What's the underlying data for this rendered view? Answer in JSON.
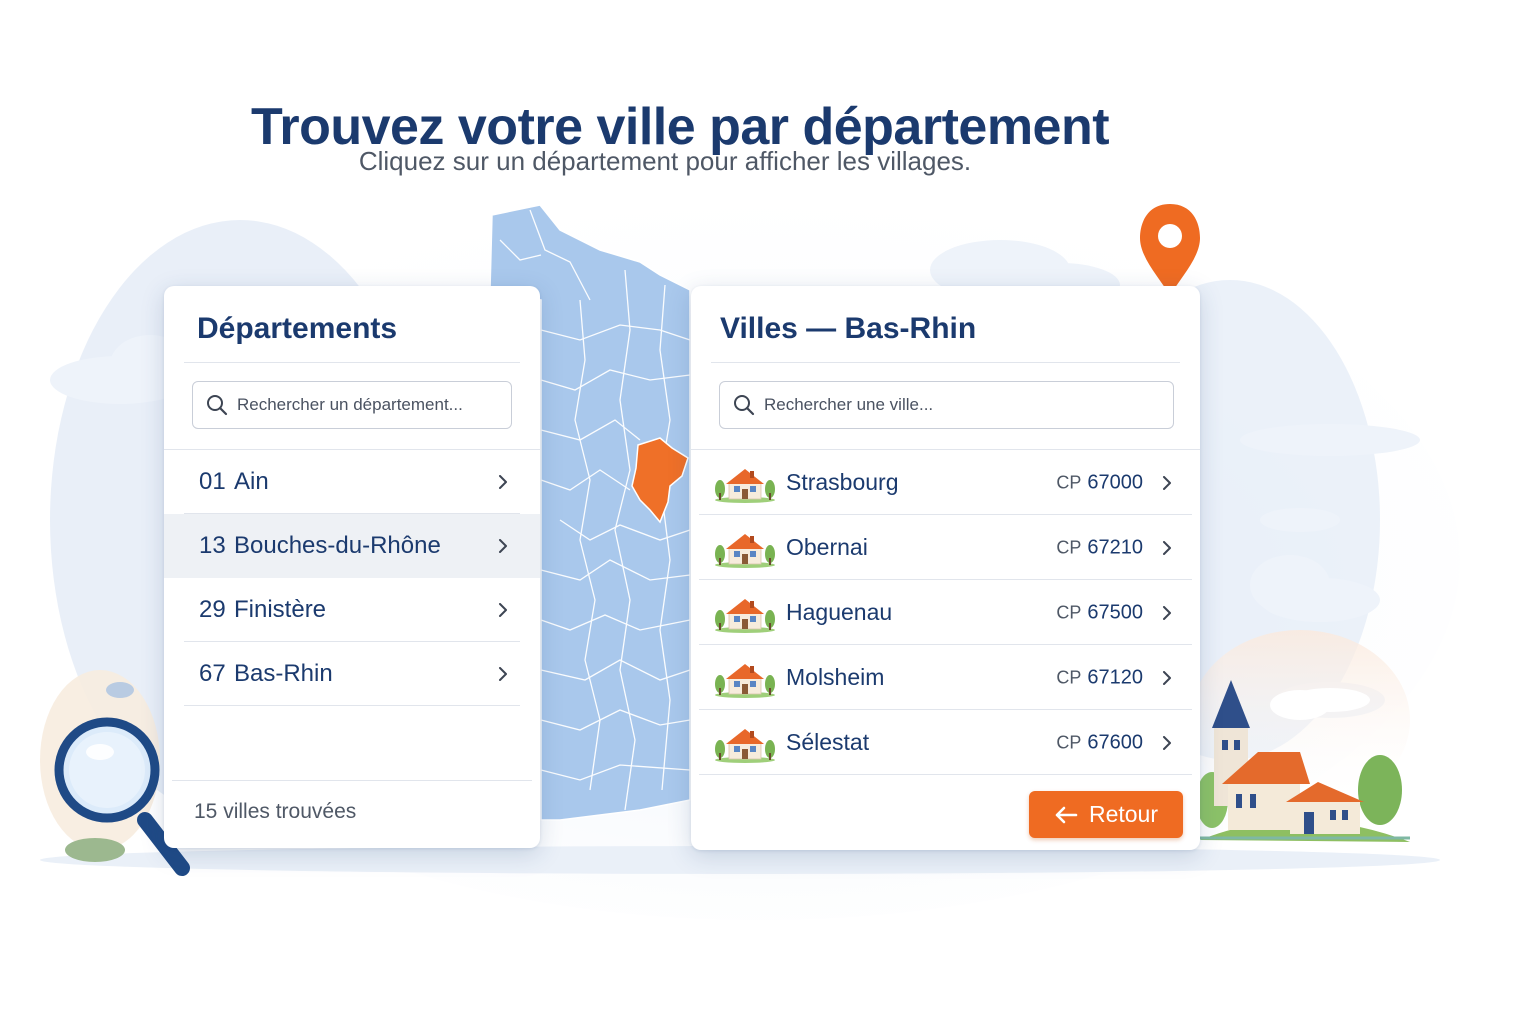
{
  "header": {
    "title": "Trouvez votre ville par département",
    "subtitle": "Cliquez sur un département pour afficher les villages."
  },
  "departments_panel": {
    "title": "Départements",
    "search_placeholder": "Rechercher un département...",
    "items": [
      {
        "code": "01",
        "name": "Ain",
        "active": false
      },
      {
        "code": "13",
        "name": "Bouches-du-Rhône",
        "active": true
      },
      {
        "code": "29",
        "name": "Finistère",
        "active": false
      },
      {
        "code": "67",
        "name": "Bas-Rhin",
        "active": false
      }
    ],
    "result_count": "15 villes trouvées"
  },
  "cities_panel": {
    "title": "Villes — Bas-Rhin",
    "search_placeholder": "Rechercher une ville...",
    "cp_prefix": "CP",
    "items": [
      {
        "name": "Strasbourg",
        "postal_code": "67000"
      },
      {
        "name": "Obernai",
        "postal_code": "67210"
      },
      {
        "name": "Haguenau",
        "postal_code": "67500"
      },
      {
        "name": "Molsheim",
        "postal_code": "67120"
      },
      {
        "name": "Sélestat",
        "postal_code": "67600"
      }
    ],
    "back_label": "Retour"
  },
  "icons": {
    "search": "search-icon",
    "chevron": "chevron-right-icon",
    "house": "house-icon",
    "back": "arrow-left-icon",
    "pin": "map-pin-icon",
    "magnifier": "magnifying-glass-icon"
  },
  "colors": {
    "primary_text": "#1b3a6e",
    "accent": "#ef6b22",
    "map_fill": "#a9c8ec",
    "highlight_region": "#ef7028"
  }
}
